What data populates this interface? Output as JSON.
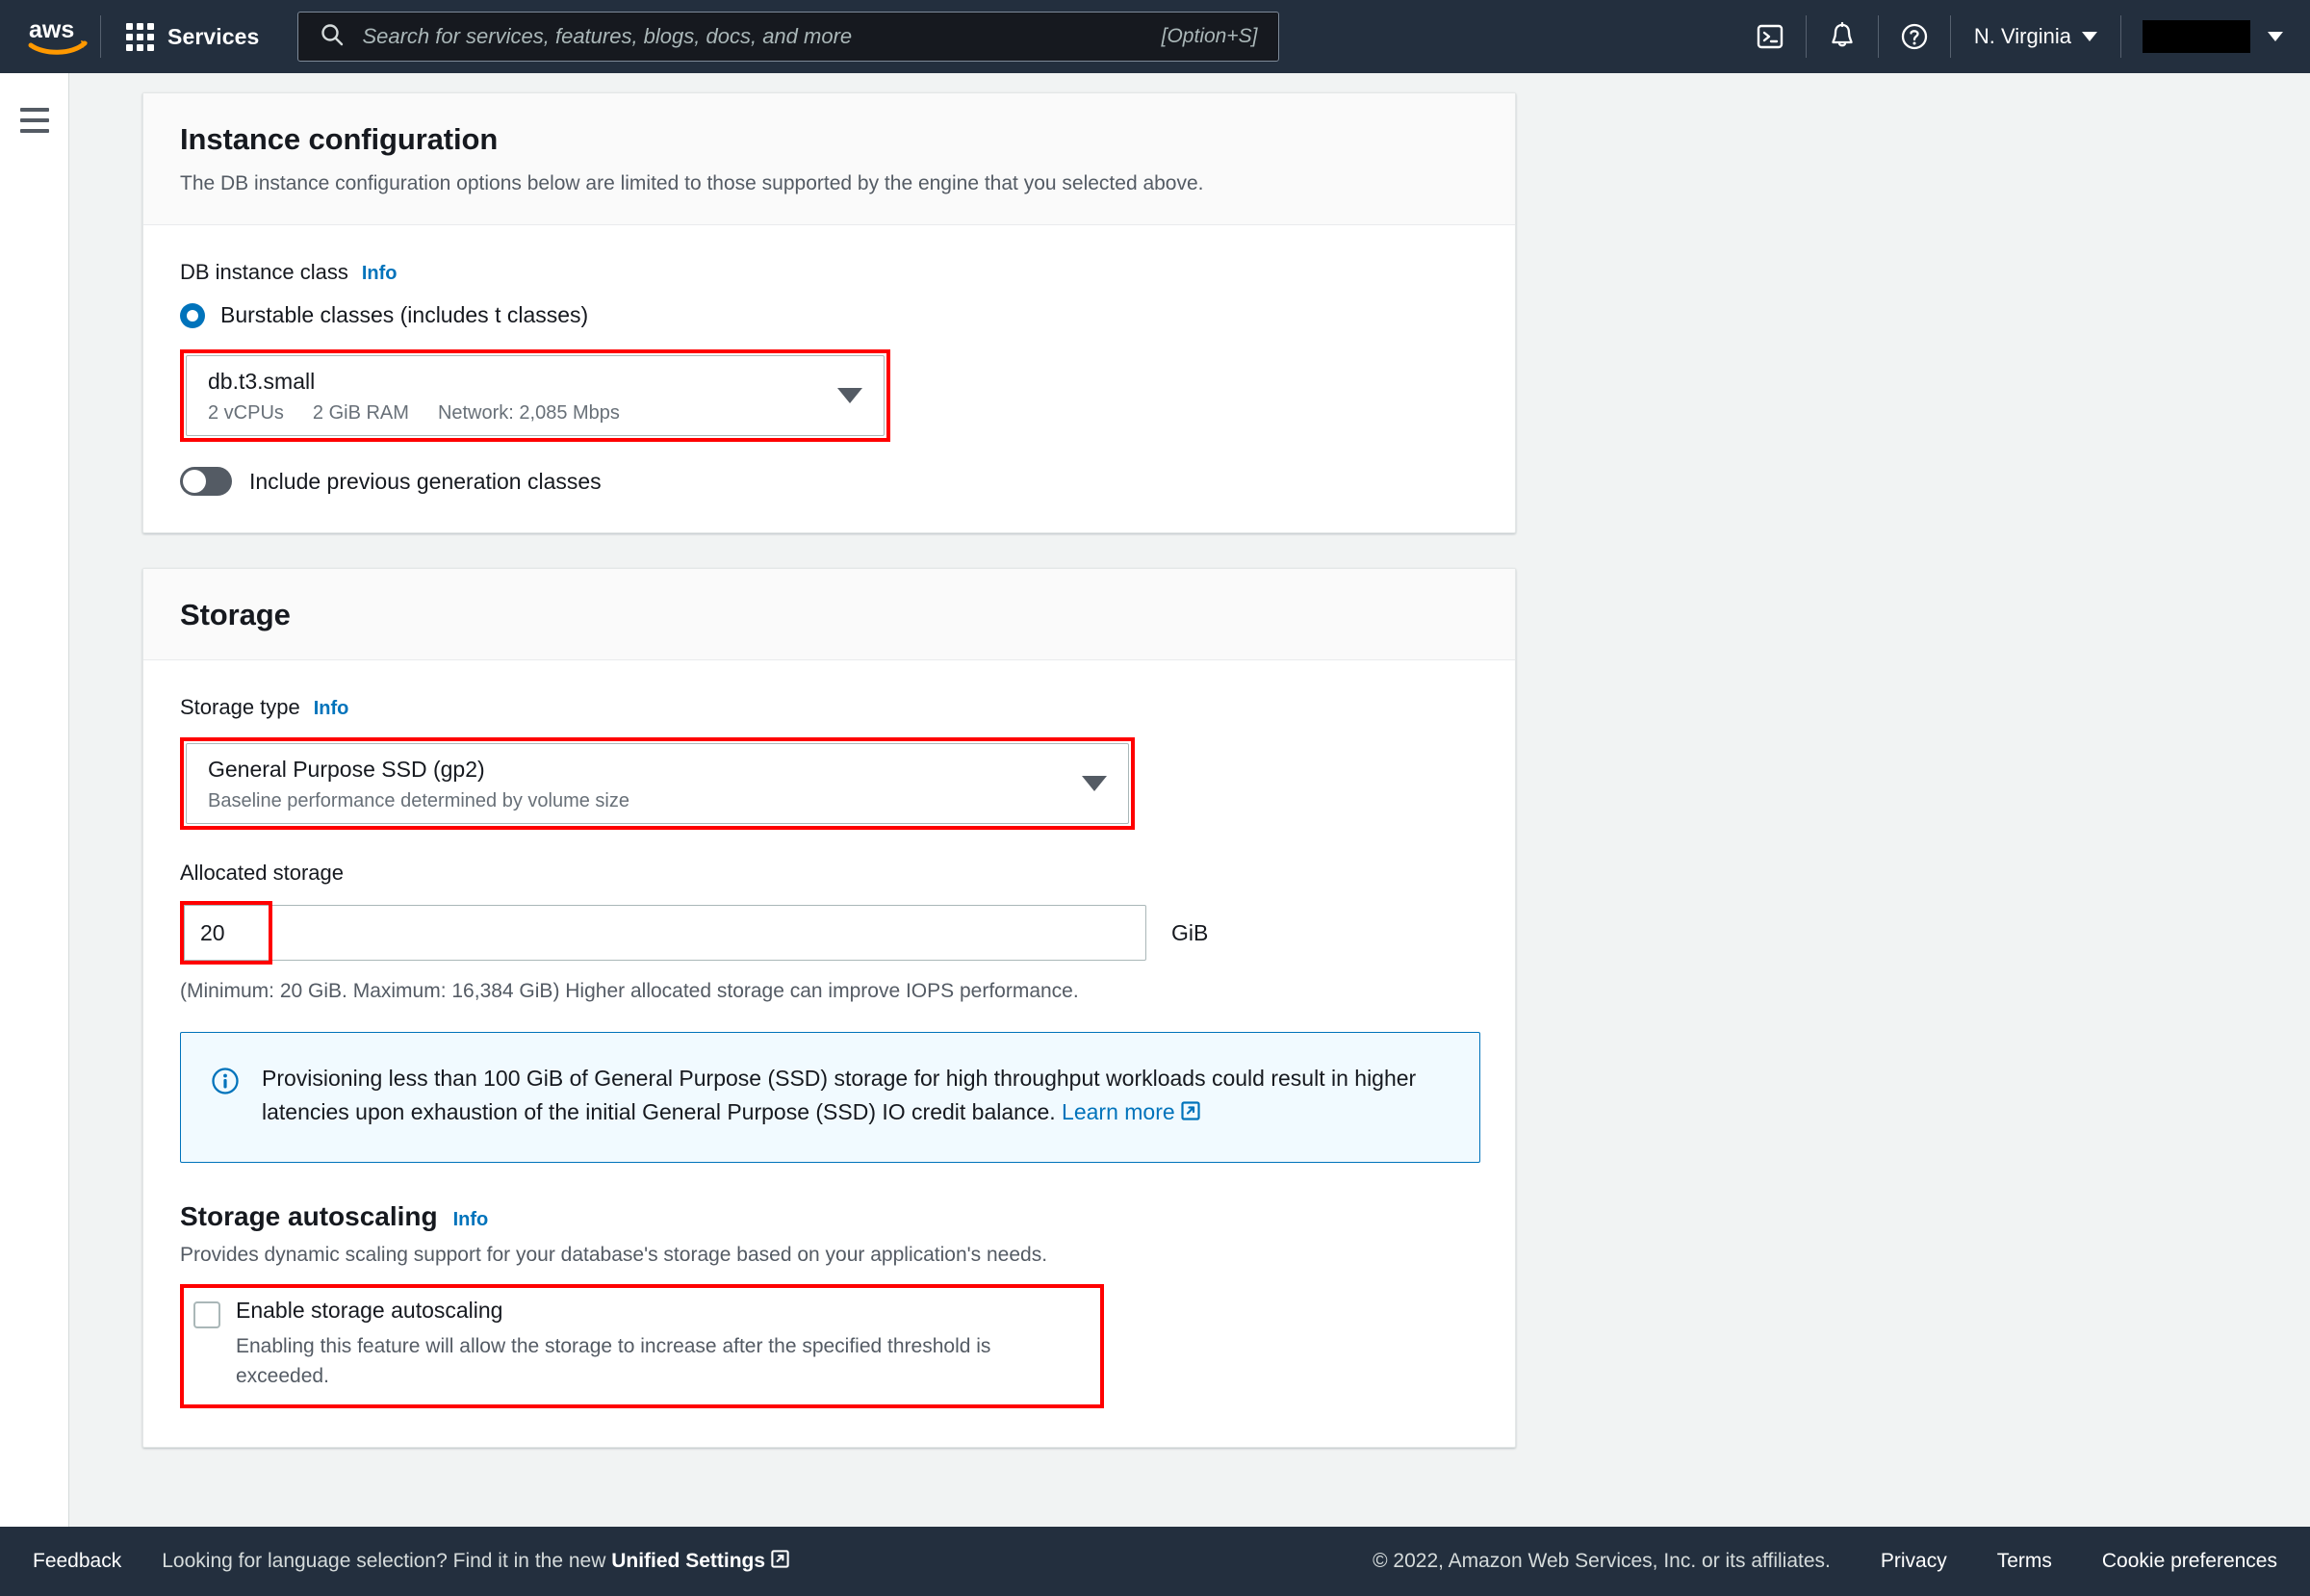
{
  "topnav": {
    "logo_alt": "aws",
    "services_label": "Services",
    "search_placeholder": "Search for services, features, blogs, docs, and more",
    "search_value": "",
    "search_shortcut": "[Option+S]",
    "cloudshell_icon": "cloudshell-icon",
    "notifications_icon": "bell-icon",
    "help_icon": "question-circle-icon",
    "region_label": "N. Virginia",
    "account_label": ""
  },
  "sidebar": {
    "menu_icon": "hamburger-menu-icon"
  },
  "instance_configuration": {
    "title": "Instance configuration",
    "description": "The DB instance configuration options below are limited to those supported by the engine that you selected above.",
    "db_instance_class": {
      "label": "DB instance class",
      "info_label": "Info",
      "radio_label": "Burstable classes (includes t classes)",
      "radio_selected": true,
      "select_value": "db.t3.small",
      "select_specs": [
        "2 vCPUs",
        "2 GiB RAM",
        "Network: 2,085 Mbps"
      ],
      "highlighted": true
    },
    "previous_generation_toggle": {
      "label": "Include previous generation classes",
      "enabled": false
    }
  },
  "storage": {
    "title": "Storage",
    "storage_type": {
      "label": "Storage type",
      "info_label": "Info",
      "select_value": "General Purpose SSD (gp2)",
      "select_description": "Baseline performance determined by volume size",
      "highlighted": true
    },
    "allocated_storage": {
      "label": "Allocated storage",
      "value": "20",
      "unit": "GiB",
      "hint": "(Minimum: 20 GiB. Maximum: 16,384 GiB) Higher allocated storage can improve IOPS performance.",
      "highlighted": true
    },
    "alert": {
      "icon": "info-circle-icon",
      "text": "Provisioning less than 100 GiB of General Purpose (SSD) storage for high throughput workloads could result in higher latencies upon exhaustion of the initial General Purpose (SSD) IO credit balance. ",
      "link_label": "Learn more"
    },
    "autoscaling": {
      "title": "Storage autoscaling",
      "info_label": "Info",
      "description": "Provides dynamic scaling support for your database's storage based on your application's needs.",
      "checkbox_label": "Enable storage autoscaling",
      "checkbox_description": "Enabling this feature will allow the storage to increase after the specified threshold is exceeded.",
      "checked": false,
      "highlighted": true
    }
  },
  "footer": {
    "feedback_label": "Feedback",
    "language_text_before": "Looking for language selection? Find it in the new ",
    "language_link": "Unified Settings",
    "copyright": "© 2022, Amazon Web Services, Inc. or its affiliates.",
    "privacy_label": "Privacy",
    "terms_label": "Terms",
    "cookie_label": "Cookie preferences"
  },
  "colors": {
    "nav_background": "#232f3e",
    "page_background": "#f1f3f3",
    "accent_blue": "#0073bb",
    "highlight_red": "#ff0000",
    "alert_background": "#f1faff"
  }
}
